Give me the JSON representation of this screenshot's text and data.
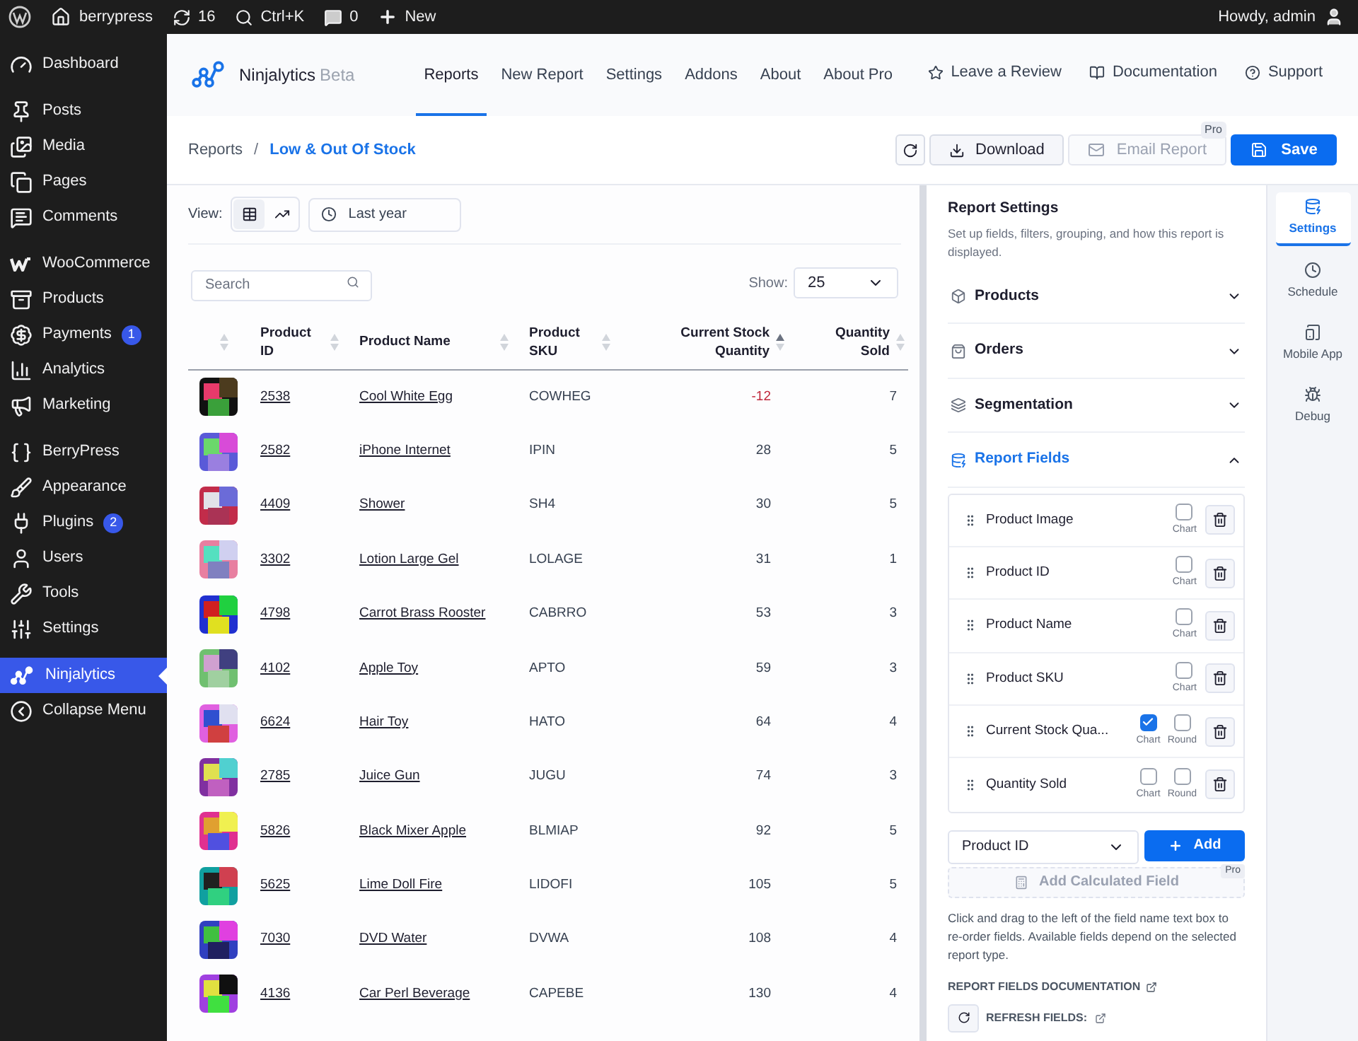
{
  "admin_bar": {
    "site": "berrypress",
    "updates": "16",
    "search": "Ctrl+K",
    "comments": "0",
    "new": "New",
    "greeting": "Howdy, admin"
  },
  "sidebar": {
    "groups": [
      [
        {
          "label": "Dashboard",
          "selected": false
        }
      ],
      [
        {
          "label": "Posts",
          "selected": false
        },
        {
          "label": "Media",
          "selected": false
        },
        {
          "label": "Pages",
          "selected": false
        },
        {
          "label": "Comments",
          "selected": false
        }
      ],
      [
        {
          "label": "WooCommerce",
          "selected": false
        },
        {
          "label": "Products",
          "selected": false
        },
        {
          "label": "Payments",
          "selected": false,
          "badge": "1"
        },
        {
          "label": "Analytics",
          "selected": false
        },
        {
          "label": "Marketing",
          "selected": false
        }
      ],
      [
        {
          "label": "BerryPress",
          "selected": false
        },
        {
          "label": "Appearance",
          "selected": false
        },
        {
          "label": "Plugins",
          "selected": false,
          "badge": "2"
        },
        {
          "label": "Users",
          "selected": false
        },
        {
          "label": "Tools",
          "selected": false
        },
        {
          "label": "Settings",
          "selected": false
        }
      ],
      [
        {
          "label": "Ninjalytics",
          "selected": true
        },
        {
          "label": "Collapse Menu",
          "selected": false
        }
      ]
    ]
  },
  "header": {
    "brand": "Ninjalytics",
    "brand_tag": "Beta",
    "nav": [
      {
        "label": "Reports",
        "selected": true
      },
      {
        "label": "New Report",
        "selected": false
      },
      {
        "label": "Settings",
        "selected": false
      },
      {
        "label": "Addons",
        "selected": false
      },
      {
        "label": "About",
        "selected": false
      },
      {
        "label": "About Pro",
        "selected": false
      }
    ],
    "links": [
      "Leave a Review",
      "Documentation",
      "Support"
    ]
  },
  "breadcrumb": {
    "parent": "Reports",
    "separator": "/",
    "current": "Low & Out Of Stock"
  },
  "actions": {
    "download": "Download",
    "email": "Email Report",
    "email_disabled": true,
    "email_badge": "Pro",
    "save": "Save"
  },
  "view": {
    "label": "View:",
    "modes": [
      {
        "selected": true
      },
      {
        "selected": false
      }
    ],
    "range": "Last year"
  },
  "search": {
    "placeholder": "Search"
  },
  "show": {
    "label": "Show:",
    "value": "25"
  },
  "table": {
    "columns": [
      {
        "label": "Product ID",
        "sorted": false
      },
      {
        "label": "Product Name",
        "sorted": false
      },
      {
        "label": "Product SKU",
        "sorted": false
      },
      {
        "label": "Current Stock Quantity",
        "sorted": true
      },
      {
        "label": "Quantity Sold",
        "sorted": false
      }
    ],
    "rows": [
      {
        "id": "2538",
        "name": "Cool White Egg",
        "sku": "COWHEG",
        "stock": "-12",
        "negative": true,
        "sold": "7"
      },
      {
        "id": "2582",
        "name": "iPhone Internet",
        "sku": "IPIN",
        "stock": "28",
        "negative": false,
        "sold": "5"
      },
      {
        "id": "4409",
        "name": "Shower",
        "sku": "SH4",
        "stock": "30",
        "negative": false,
        "sold": "5"
      },
      {
        "id": "3302",
        "name": "Lotion Large Gel",
        "sku": "LOLAGE",
        "stock": "31",
        "negative": false,
        "sold": "1"
      },
      {
        "id": "4798",
        "name": "Carrot Brass Rooster",
        "sku": "CABRRO",
        "stock": "53",
        "negative": false,
        "sold": "3"
      },
      {
        "id": "4102",
        "name": "Apple Toy",
        "sku": "APTO",
        "stock": "59",
        "negative": false,
        "sold": "3"
      },
      {
        "id": "6624",
        "name": "Hair Toy",
        "sku": "HATO",
        "stock": "64",
        "negative": false,
        "sold": "4"
      },
      {
        "id": "2785",
        "name": "Juice Gun",
        "sku": "JUGU",
        "stock": "74",
        "negative": false,
        "sold": "3"
      },
      {
        "id": "5826",
        "name": "Black Mixer Apple",
        "sku": "BLMIAP",
        "stock": "92",
        "negative": false,
        "sold": "5"
      },
      {
        "id": "5625",
        "name": "Lime Doll Fire",
        "sku": "LIDOFI",
        "stock": "105",
        "negative": false,
        "sold": "5"
      },
      {
        "id": "7030",
        "name": "DVD Water",
        "sku": "DVWA",
        "stock": "108",
        "negative": false,
        "sold": "4"
      },
      {
        "id": "4136",
        "name": "Car Perl Beverage",
        "sku": "CAPEBE",
        "stock": "130",
        "negative": false,
        "sold": "4"
      }
    ]
  },
  "settings": {
    "title": "Report Settings",
    "description": "Set up fields, filters, grouping, and how this report is displayed.",
    "sections": [
      {
        "label": "Products",
        "expanded": false
      },
      {
        "label": "Orders",
        "expanded": false
      },
      {
        "label": "Segmentation",
        "expanded": false
      },
      {
        "label": "Report Fields",
        "expanded": true
      }
    ],
    "fields": [
      {
        "label": "Product Image",
        "options": [
          {
            "label": "Chart",
            "checked": false
          }
        ]
      },
      {
        "label": "Product ID",
        "options": [
          {
            "label": "Chart",
            "checked": false
          }
        ]
      },
      {
        "label": "Product Name",
        "options": [
          {
            "label": "Chart",
            "checked": false
          }
        ]
      },
      {
        "label": "Product SKU",
        "options": [
          {
            "label": "Chart",
            "checked": false
          }
        ]
      },
      {
        "label": "Current Stock Qua...",
        "options": [
          {
            "label": "Chart",
            "checked": true
          },
          {
            "label": "Round",
            "checked": false
          }
        ]
      },
      {
        "label": "Quantity Sold",
        "options": [
          {
            "label": "Chart",
            "checked": false
          },
          {
            "label": "Round",
            "checked": false
          }
        ]
      }
    ],
    "field_select": "Product ID",
    "add": "Add",
    "calculated": "Add Calculated Field",
    "calculated_badge": "Pro",
    "help": "Click and drag to the left of the field name text box to re-order fields. Available fields depend on the selected report type.",
    "doc_link": "REPORT FIELDS DOCUMENTATION",
    "refresh": "REFRESH FIELDS:"
  },
  "side_tabs": [
    {
      "label": "Settings",
      "selected": true
    },
    {
      "label": "Schedule",
      "selected": false
    },
    {
      "label": "Mobile App",
      "selected": false
    },
    {
      "label": "Debug",
      "selected": false
    }
  ]
}
